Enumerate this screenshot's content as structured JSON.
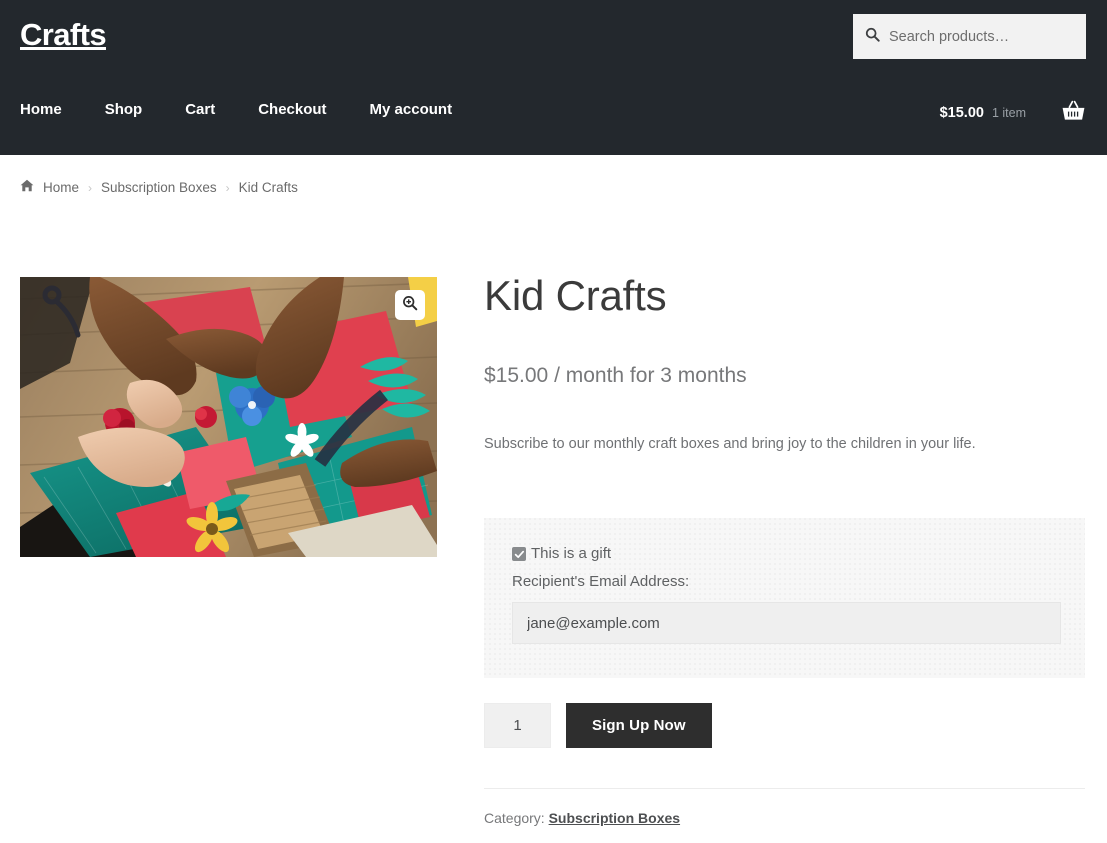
{
  "header": {
    "site_title": "Crafts",
    "search": {
      "placeholder": "Search products…",
      "value": "",
      "icon": "search-icon"
    },
    "nav": [
      {
        "label": "Home"
      },
      {
        "label": "Shop"
      },
      {
        "label": "Cart"
      },
      {
        "label": "Checkout"
      },
      {
        "label": "My account"
      }
    ],
    "cart": {
      "total": "$15.00",
      "count": "1 item",
      "icon": "shopping-basket-icon"
    },
    "background_color": "#23282d"
  },
  "breadcrumb": {
    "home_icon": "home-icon",
    "items": [
      {
        "label": "Home"
      },
      {
        "label": "Subscription Boxes"
      },
      {
        "label": "Kid Crafts"
      }
    ],
    "separator": "›"
  },
  "gallery": {
    "zoom_icon": "magnifier-plus-icon",
    "image_alt": "Overhead photo of hands making paper flower crafts on teal cutting mats at a wooden table"
  },
  "product": {
    "title": "Kid Crafts",
    "price": "$15.00 / month for 3 months",
    "description": "Subscribe to our monthly craft boxes and bring joy to the children in your life."
  },
  "gift": {
    "checkbox_label": "This is a gift",
    "checked": true,
    "check_glyph": "✓",
    "email_label": "Recipient's Email Address:",
    "email_value": "jane@example.com",
    "email_placeholder": ""
  },
  "cart_form": {
    "quantity": "1",
    "submit_label": "Sign Up Now"
  },
  "meta": {
    "category_label": "Category:",
    "category_value": "Subscription Boxes"
  },
  "colors": {
    "header_bg": "#23282d",
    "button_bg": "#2e2e2e",
    "gift_box_bg": "#f7f7f7",
    "text_muted": "#77787a"
  }
}
